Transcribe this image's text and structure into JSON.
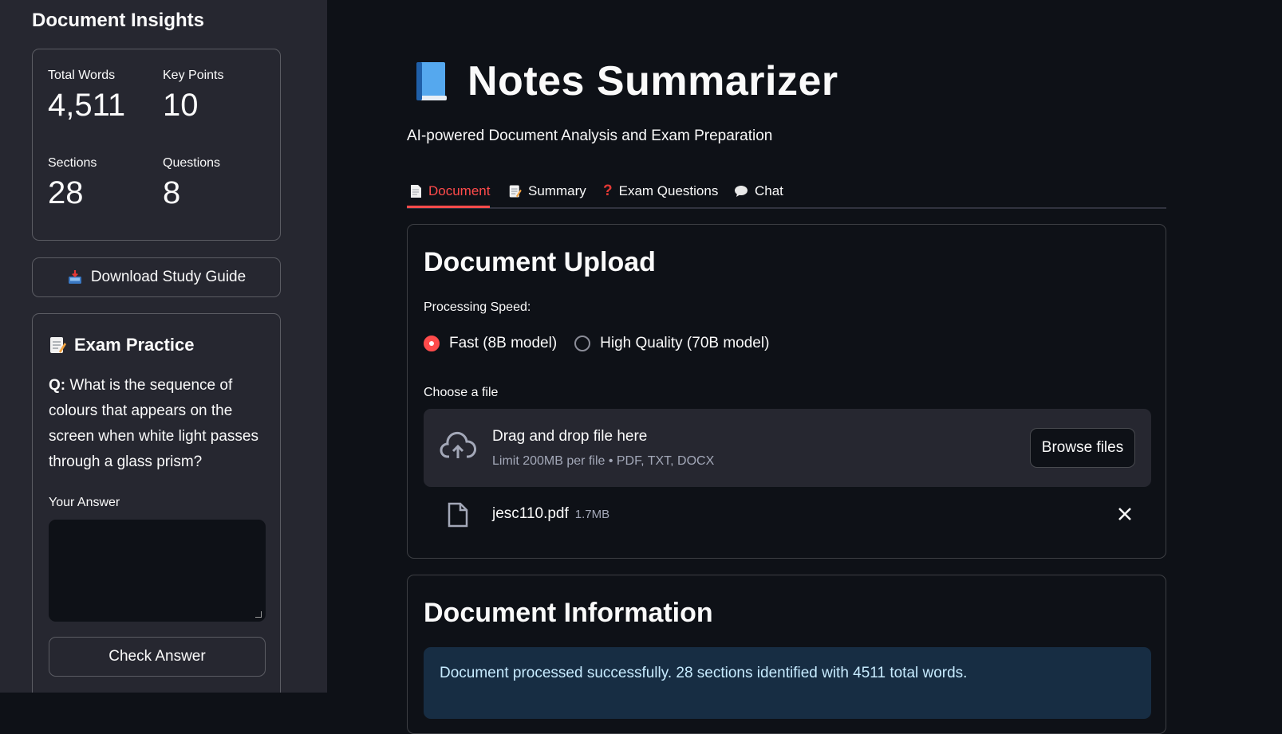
{
  "sidebar": {
    "title": "Document Insights",
    "metrics": [
      {
        "label": "Total Words",
        "value": "4,511"
      },
      {
        "label": "Key Points",
        "value": "10"
      },
      {
        "label": "Sections",
        "value": "28"
      },
      {
        "label": "Questions",
        "value": "8"
      }
    ],
    "download_button": {
      "icon": "inbox-tray-icon",
      "label": "Download Study Guide"
    },
    "exam": {
      "icon": "memo-icon",
      "title": "Exam Practice",
      "question_prefix": "Q:",
      "question": "What is the sequence of colours that appears on the screen when white light passes through a glass prism?",
      "answer_label": "Your Answer",
      "answer_value": "",
      "check_button": "Check Answer"
    }
  },
  "main": {
    "title": "Notes Summarizer",
    "title_icon": "blue-book-icon",
    "subtitle": "AI-powered Document Analysis and Exam Preparation",
    "tabs": [
      {
        "icon": "page-icon",
        "label": "Document",
        "active": true
      },
      {
        "icon": "memo-icon",
        "label": "Summary",
        "active": false
      },
      {
        "icon": "question-mark-icon",
        "label": "Exam Questions",
        "active": false
      },
      {
        "icon": "speech-bubble-icon",
        "label": "Chat",
        "active": false
      }
    ],
    "upload": {
      "heading": "Document Upload",
      "speed_label": "Processing Speed:",
      "options": [
        {
          "label": "Fast (8B model)",
          "selected": true
        },
        {
          "label": "High Quality (70B model)",
          "selected": false
        }
      ],
      "choose_label": "Choose a file",
      "dropzone_title": "Drag and drop file here",
      "dropzone_limit": "Limit 200MB per file • PDF, TXT, DOCX",
      "browse_button": "Browse files",
      "file": {
        "name": "jesc110.pdf",
        "size": "1.7MB"
      }
    },
    "info": {
      "heading": "Document Information",
      "message": "Document processed successfully. 28 sections identified with 4511 total words."
    }
  },
  "colors": {
    "accent": "#ff4b4b",
    "background": "#0e1117",
    "sidebar": "#262730",
    "info_bg": "#172d43",
    "info_text": "#c7ebff"
  }
}
